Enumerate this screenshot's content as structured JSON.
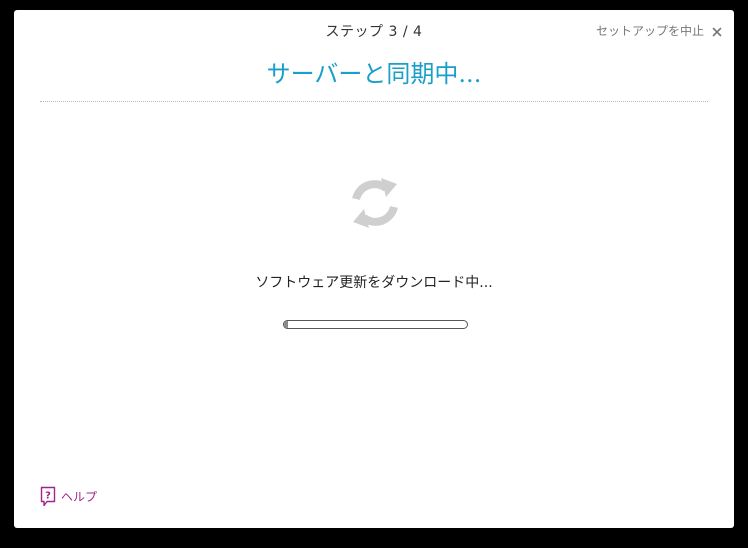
{
  "header": {
    "step": "ステップ 3 / 4",
    "cancel_label": "セットアップを中止",
    "title": "サーバーと同期中..."
  },
  "main": {
    "status": "ソフトウェア更新をダウンロード中...",
    "progress_percent": 2,
    "icon": "sync-icon"
  },
  "footer": {
    "help_label": "ヘルプ",
    "help_icon": "help-icon"
  },
  "colors": {
    "title": "#1aa0c8",
    "help": "#a0248c",
    "icon_gray": "#cfcfcf"
  }
}
